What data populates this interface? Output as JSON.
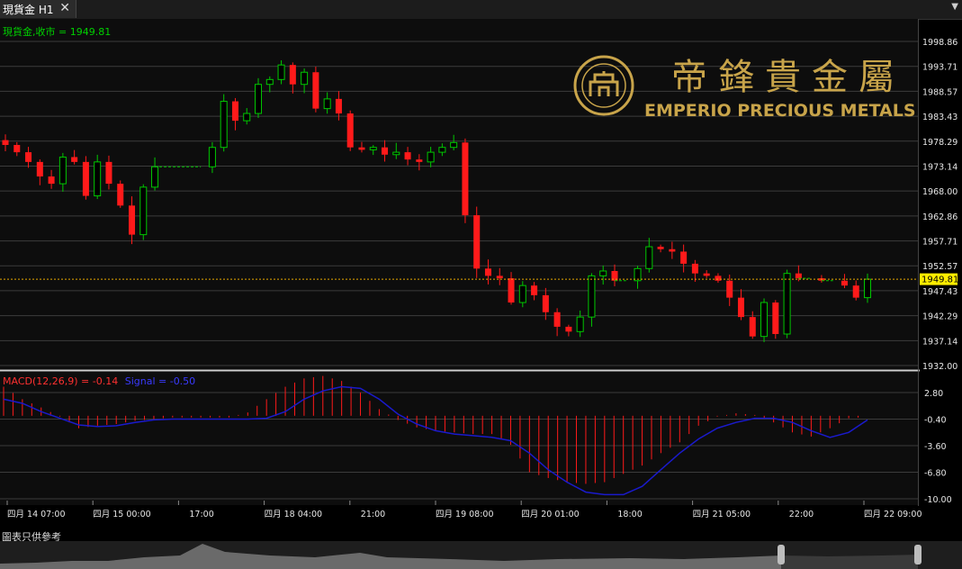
{
  "window": {
    "tab_title": "現貨金 H1",
    "close_symbol": "✕",
    "menu_symbol": "▼"
  },
  "chart_data": [
    {
      "type": "candlestick",
      "symbol_label": "現貨金,收市 = 1949.81",
      "last_price": 1949.81,
      "ylim": [
        1932.0,
        1998.86
      ],
      "y_ticks": [
        1998.86,
        1993.71,
        1988.57,
        1983.43,
        1978.29,
        1973.14,
        1968.0,
        1962.86,
        1957.71,
        1952.57,
        1947.43,
        1942.29,
        1937.14,
        1932.0
      ],
      "y_tick_labels": [
        "1998.86",
        "1993.71",
        "1988.57",
        "1983.43",
        "1978.29",
        "1973.14",
        "1968.00",
        "1962.86",
        "1957.71",
        "1952.57",
        "1947.43",
        "1942.29",
        "1937.14",
        "1932.00"
      ],
      "price_line_label": "1949.81",
      "colors": {
        "up": "#00c800",
        "down": "#ff1a1a",
        "flat": "#00c800",
        "price_line": "#e6a800",
        "grid": "#3c3c3c"
      },
      "close_path": [
        1977.5,
        1976,
        1974,
        1971,
        1969.5,
        1975,
        1974,
        1967,
        1974,
        1969.5,
        1965,
        1959,
        1968.8,
        1973,
        1973,
        1973,
        1973,
        1973,
        1977,
        1986.5,
        1982.5,
        1984,
        1990,
        1991,
        1994,
        1990,
        1992.5,
        1985,
        1987,
        1984,
        1977,
        1976.5,
        1977,
        1975.5,
        1976,
        1974.5,
        1974,
        1976,
        1977,
        1978,
        1963,
        1952,
        1950.5,
        1950,
        1945,
        1948.5,
        1946.5,
        1943,
        1940,
        1939,
        1942,
        1950.5,
        1951.5,
        1949.5,
        1949.5,
        1952,
        1956.5,
        1956,
        1955.5,
        1953,
        1951,
        1950.5,
        1949.5,
        1946,
        1942,
        1938,
        1945,
        1938.5,
        1951,
        1950,
        1950,
        1949.5,
        1949.5,
        1948.5,
        1946,
        1949.81
      ]
    },
    {
      "type": "macd",
      "label": "MACD(12,26,9) = -0.14",
      "signal_label": "Signal = -0.50",
      "ylim": [
        -10.0,
        2.8
      ],
      "y_ticks": [
        2.8,
        -0.4,
        -3.6,
        -6.8,
        -10.0
      ],
      "y_tick_labels": [
        "2.80",
        "-0.40",
        "-3.60",
        "-6.80",
        "-10.00"
      ],
      "macd_values": [
        3.5,
        2.0,
        1.0,
        -0.1,
        -1.5,
        -1.2,
        -1.0,
        -0.6,
        -0.4,
        -0.2,
        -0.2,
        -0.2,
        -0.2,
        0.4,
        2.0,
        3.5,
        4.5,
        4.8,
        4.2,
        2.8,
        0.8,
        -0.5,
        -1.4,
        -1.8,
        -2.0,
        -2.2,
        -2.2,
        -3.5,
        -6.8,
        -7.5,
        -8.0,
        -8.2,
        -8.0,
        -7.0,
        -6.0,
        -4.5,
        -3.2,
        -1.2,
        -0.1,
        0.3,
        0.1,
        -0.8,
        -2.0,
        -2.5,
        -1.5,
        -0.3,
        -0.14
      ],
      "signal_values": [
        2.0,
        1.5,
        0.5,
        -0.3,
        -1.1,
        -1.3,
        -1.2,
        -0.8,
        -0.5,
        -0.4,
        -0.4,
        -0.4,
        -0.4,
        -0.4,
        -0.3,
        0.5,
        2.0,
        3.0,
        3.5,
        3.3,
        2.0,
        0.2,
        -1.0,
        -1.8,
        -2.2,
        -2.4,
        -2.6,
        -3.0,
        -4.5,
        -6.5,
        -8.0,
        -9.2,
        -9.5,
        -9.5,
        -8.5,
        -6.5,
        -4.5,
        -2.8,
        -1.5,
        -0.8,
        -0.3,
        -0.3,
        -0.8,
        -1.8,
        -2.6,
        -2.0,
        -0.5
      ],
      "colors": {
        "histogram": "#ff1a1a",
        "signal": "#1a1acc",
        "macd_label": "#ff3030",
        "signal_label": "#3a3aff"
      }
    }
  ],
  "time_axis": {
    "labels": [
      "四月 14 07:00",
      "四月 15 00:00",
      "17:00",
      "四月 18 04:00",
      "21:00",
      "四月 19 08:00",
      "四月 20 01:00",
      "18:00",
      "四月 21 05:00",
      "22:00",
      "四月 22 09:00"
    ]
  },
  "watermark": {
    "chinese_name": "帝鋒貴金屬",
    "english_name": "EMPERIO PRECIOUS METALS",
    "color": "#c8a44a"
  },
  "footer": {
    "disclaimer": "圖表只供參考"
  }
}
